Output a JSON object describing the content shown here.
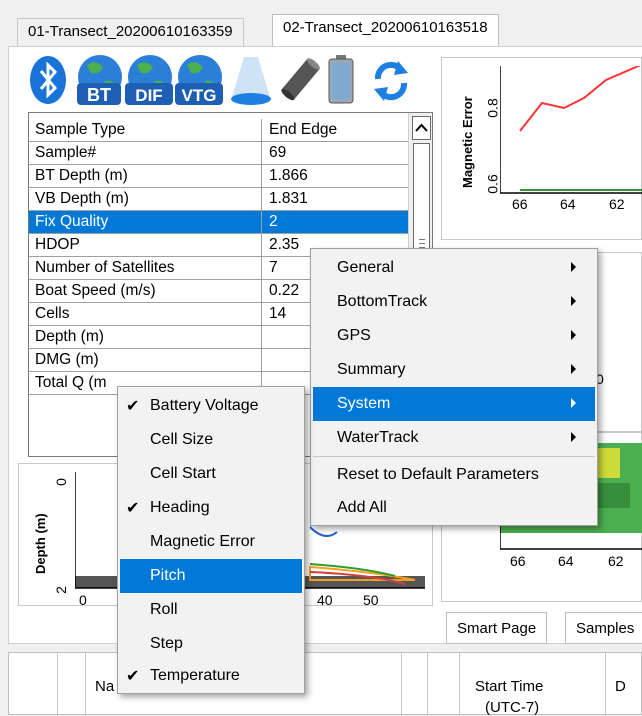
{
  "tabs": {
    "tab1": "01-Transect_20200610163359",
    "tab2": "02-Transect_20200610163518"
  },
  "toolbar": {
    "icons": [
      "bluetooth-icon",
      "globe-bt-icon",
      "globe-dif-icon",
      "globe-vtg-icon",
      "light-beam-icon",
      "transducer-icon",
      "battery-icon",
      "refresh-icon"
    ],
    "bt_text": "BT",
    "dif_text": "DIF",
    "vtg_text": "VTG"
  },
  "grid": {
    "rows": [
      {
        "name": "Sample Type",
        "value": "End Edge"
      },
      {
        "name": "Sample#",
        "value": "69"
      },
      {
        "name": "BT Depth (m)",
        "value": "1.866"
      },
      {
        "name": "VB Depth (m)",
        "value": "1.831"
      },
      {
        "name": "Fix Quality",
        "value": "2"
      },
      {
        "name": "HDOP",
        "value": "2.35"
      },
      {
        "name": "Number of Satellites",
        "value": "7"
      },
      {
        "name": "Boat Speed (m/s)",
        "value": "0.22"
      },
      {
        "name": "Cells",
        "value": "14"
      },
      {
        "name": "Depth (m)",
        "value": ""
      },
      {
        "name": "DMG (m)",
        "value": ""
      },
      {
        "name": "Total Q (m",
        "value": ""
      }
    ]
  },
  "top_chart": {
    "ylabel": "Magnetic Error",
    "yticks": [
      "0.8",
      "0.6"
    ],
    "xticks": [
      "66",
      "64",
      "62"
    ]
  },
  "depth_chart": {
    "ylabel": "Depth (m)",
    "yticks": [
      "0",
      "2"
    ],
    "xticks": [
      "0",
      "40",
      "50"
    ]
  },
  "mid_chart": {
    "tick0": "0"
  },
  "heat_chart": {
    "xticks": [
      "66",
      "64",
      "62"
    ]
  },
  "bottom_tabs": {
    "smart_page": "Smart Page",
    "samples": "Samples"
  },
  "table": {
    "col_name": "Na",
    "col_start_time": "Start Time",
    "col_start_time_sub": "(UTC-7)",
    "col_d": "D"
  },
  "context_menu": {
    "items": [
      {
        "label": "General",
        "submenu": true
      },
      {
        "label": "BottomTrack",
        "submenu": true
      },
      {
        "label": "GPS",
        "submenu": true
      },
      {
        "label": "Summary",
        "submenu": true
      },
      {
        "label": "System",
        "submenu": true,
        "highlighted": true
      },
      {
        "label": "WaterTrack",
        "submenu": true
      },
      {
        "label": "Reset to Default Parameters",
        "submenu": false
      },
      {
        "label": "Add All",
        "submenu": false
      }
    ]
  },
  "submenu": {
    "items": [
      {
        "label": "Battery Voltage",
        "checked": true
      },
      {
        "label": "Cell Size",
        "checked": false
      },
      {
        "label": "Cell Start",
        "checked": false
      },
      {
        "label": "Heading",
        "checked": true
      },
      {
        "label": "Magnetic Error",
        "checked": false
      },
      {
        "label": "Pitch",
        "checked": false,
        "highlighted": true
      },
      {
        "label": "Roll",
        "checked": false
      },
      {
        "label": "Step",
        "checked": false
      },
      {
        "label": "Temperature",
        "checked": true
      }
    ],
    "check_glyph": "✔"
  },
  "colors": {
    "highlight": "#0078d7",
    "line_red": "#ff3333"
  }
}
